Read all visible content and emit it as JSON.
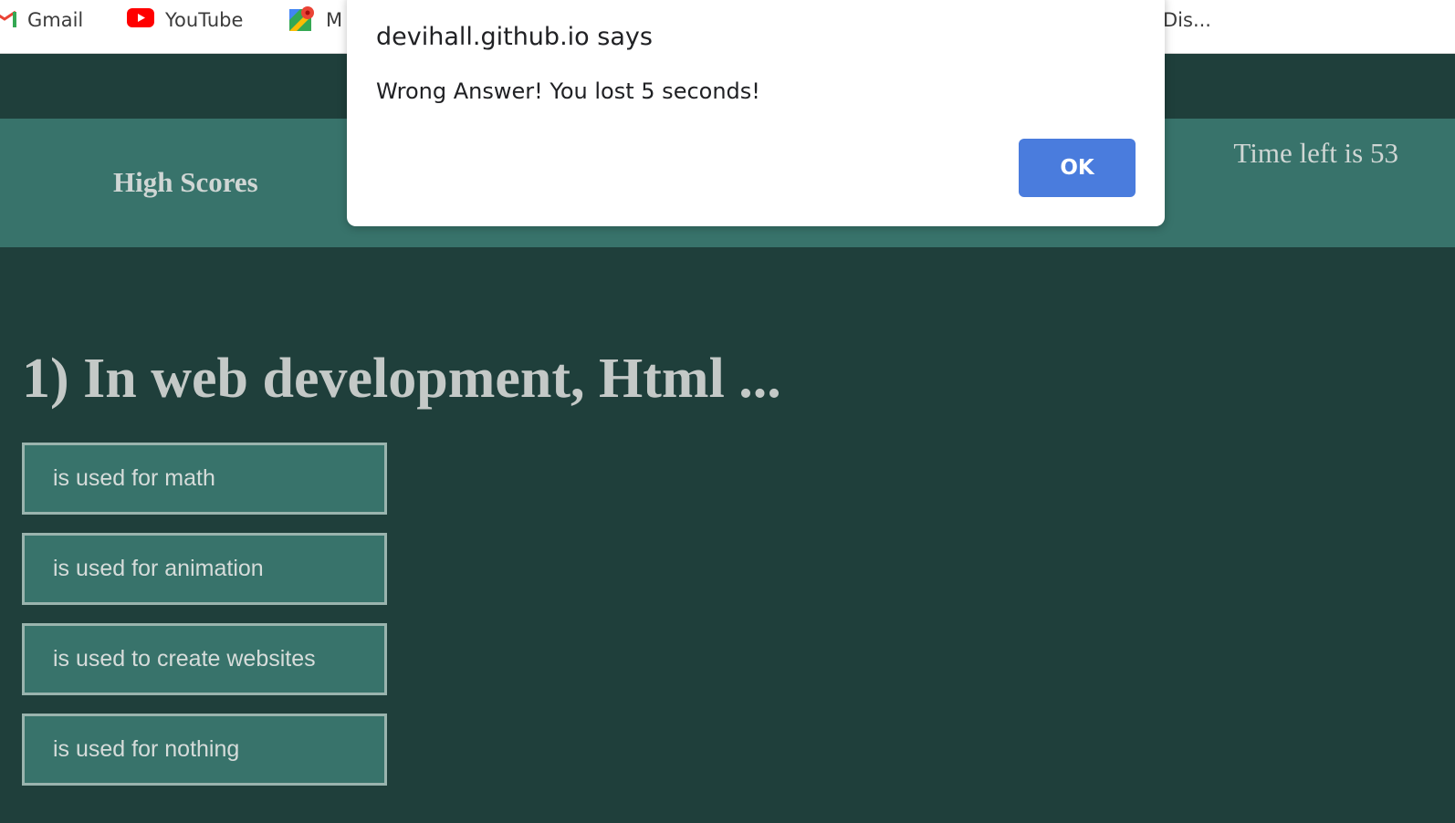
{
  "bookmarks": [
    {
      "label": "Gmail",
      "icon": "gmail-icon"
    },
    {
      "label": "YouTube",
      "icon": "youtube-icon"
    },
    {
      "label": "M",
      "icon": "maps-icon"
    },
    {
      "label": "Dis..."
    }
  ],
  "header": {
    "high_scores_label": "High Scores",
    "timer_text": "Time left is 53"
  },
  "quiz": {
    "question": "1) In web development, Html ...",
    "answers": [
      "is used for math",
      "is used for animation",
      "is used to create websites",
      "is used for nothing"
    ]
  },
  "dialog": {
    "title": "devihall.github.io says",
    "message": "Wrong Answer! You lost 5 seconds!",
    "ok_label": "OK"
  },
  "colors": {
    "page_background": "#1f3f3b",
    "header_band": "#38736b",
    "answer_background": "#38736b",
    "answer_border": "#9ab4ae",
    "dialog_button": "#4a7cdd"
  }
}
